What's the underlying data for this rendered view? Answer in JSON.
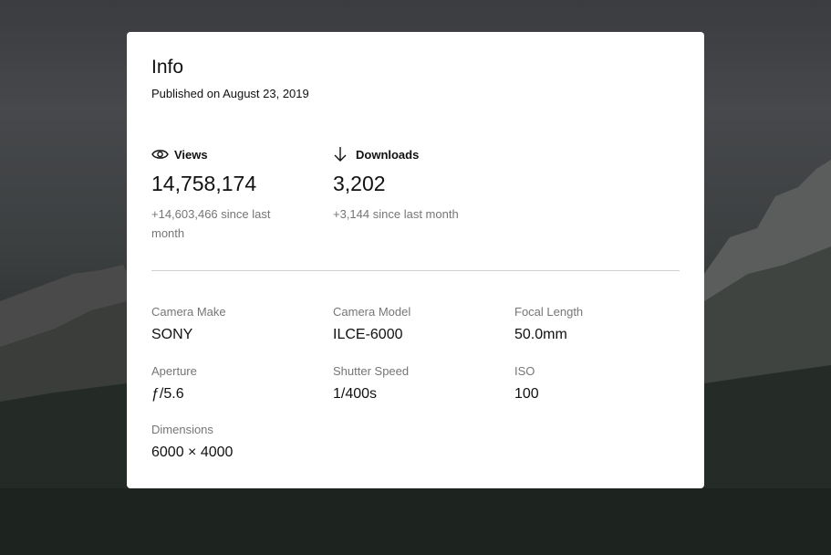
{
  "info": {
    "title": "Info",
    "published": "Published on August 23, 2019"
  },
  "stats": {
    "views": {
      "label": "Views",
      "icon": "eye-icon",
      "value": "14,758,174",
      "delta": "+14,603,466 since last month"
    },
    "downloads": {
      "label": "Downloads",
      "icon": "arrow-down-icon",
      "value": "3,202",
      "delta": "+3,144 since last month"
    }
  },
  "specs": {
    "camera_make": {
      "label": "Camera Make",
      "value": "SONY"
    },
    "camera_model": {
      "label": "Camera Model",
      "value": "ILCE-6000"
    },
    "focal_length": {
      "label": "Focal Length",
      "value": "50.0mm"
    },
    "aperture": {
      "label": "Aperture",
      "value": "ƒ/5.6"
    },
    "shutter_speed": {
      "label": "Shutter Speed",
      "value": "1/400s"
    },
    "iso": {
      "label": "ISO",
      "value": "100"
    },
    "dimensions": {
      "label": "Dimensions",
      "value": "6000 × 4000"
    }
  },
  "colors": {
    "panel": "#ffffff",
    "text": "#111111",
    "muted": "#767676",
    "divider": "#d1d1d1"
  }
}
